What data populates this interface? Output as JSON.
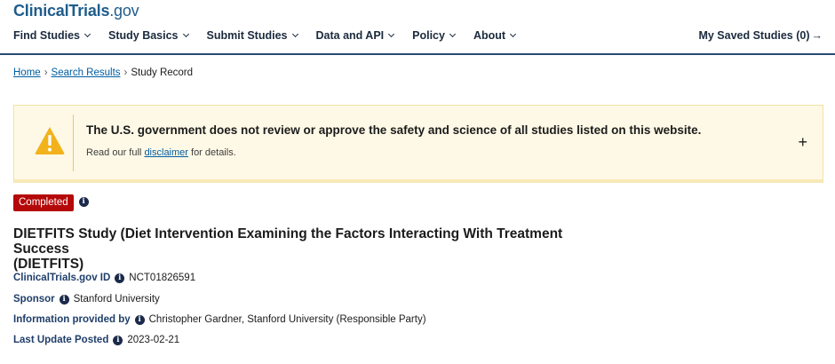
{
  "header": {
    "logo_text": "ClinicalTrials",
    "logo_suffix": ".gov",
    "nav": [
      {
        "label": "Find Studies"
      },
      {
        "label": "Study Basics"
      },
      {
        "label": "Submit Studies"
      },
      {
        "label": "Data and API"
      },
      {
        "label": "Policy"
      },
      {
        "label": "About"
      }
    ],
    "saved_label": "My Saved Studies (0)",
    "saved_arrow": "→"
  },
  "breadcrumb": {
    "home": "Home",
    "search_results": "Search Results",
    "current": "Study Record",
    "separator": "›"
  },
  "alert": {
    "title": "The U.S. government does not review or approve the safety and science of all studies listed on this website.",
    "body_prefix": "Read our full ",
    "body_link": "disclaimer",
    "body_suffix": " for details.",
    "expand_symbol": "+",
    "icon_color": "#f2b21b"
  },
  "study": {
    "status": "Completed",
    "status_color": "#b50909",
    "title_line1": "DIETFITS Study (Diet Intervention Examining the Factors Interacting With Treatment Success",
    "title_line2": "(DIETFITS)",
    "fields": [
      {
        "label": "ClinicalTrials.gov ID",
        "value": "NCT01826591"
      },
      {
        "label": "Sponsor",
        "value": "Stanford University"
      },
      {
        "label": "Information provided by",
        "value": "Christopher Gardner, Stanford University (Responsible Party)"
      },
      {
        "label": "Last Update Posted",
        "value": "2023-02-21"
      }
    ]
  },
  "icons": {
    "info_glyph": "i",
    "warning_glyph": "!"
  }
}
